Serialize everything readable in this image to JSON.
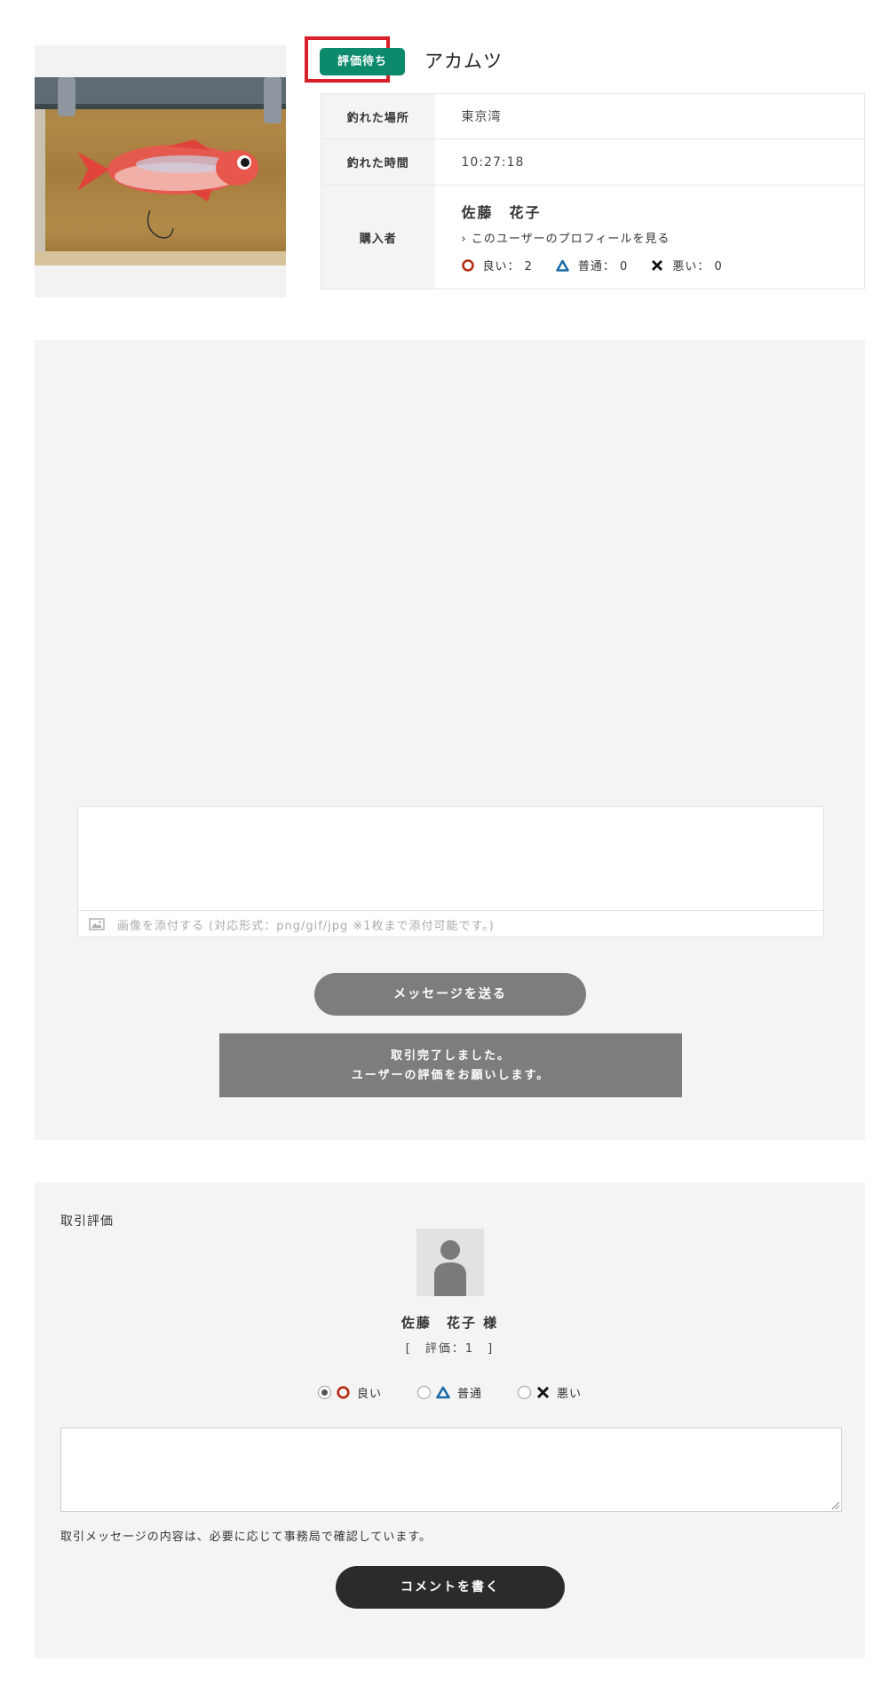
{
  "item": {
    "status_badge": "評価待ち",
    "name": "アカムツ",
    "image": "fish-photo"
  },
  "details": {
    "location_label": "釣れた場所",
    "location_value": "東京湾",
    "time_label": "釣れた時間",
    "time_value": "10:27:18",
    "buyer_label": "購入者",
    "buyer_name": "佐藤　花子",
    "profile_link": "このユーザーのプロフィールを見る",
    "ratings": [
      {
        "icon": "circle-icon",
        "text": "良い： 2"
      },
      {
        "icon": "triangle-icon",
        "text": "普通： 0"
      },
      {
        "icon": "cross-icon",
        "text": "悪い： 0"
      }
    ]
  },
  "message": {
    "attach_text": "画像を添付する (対応形式：png/gif/jpg ※1枚まで添付可能です。)",
    "send_button": "メッセージを送る",
    "complete_line1": "取引完了しました。",
    "complete_line2": "ユーザーの評価をお願いします。"
  },
  "review": {
    "title": "取引評価",
    "user_name": "佐藤　花子 様",
    "user_score": "[　評価：1　]",
    "options": [
      {
        "label": "良い",
        "checked": true,
        "icon": "circle-icon"
      },
      {
        "label": "普通",
        "checked": false,
        "icon": "triangle-icon"
      },
      {
        "label": "悪い",
        "checked": false,
        "icon": "cross-icon"
      }
    ],
    "note": "取引メッセージの内容は、必要に応じて事務局で確認しています。",
    "comment_button": "コメントを書く"
  },
  "colors": {
    "badge": "#0c8a6b",
    "highlight_outline": "#d8202a",
    "good": "#b5290f",
    "normal": "#1a6aa8",
    "bad": "#111111",
    "button_gray": "#7d7d7d",
    "button_dark": "#2b2b2b"
  }
}
